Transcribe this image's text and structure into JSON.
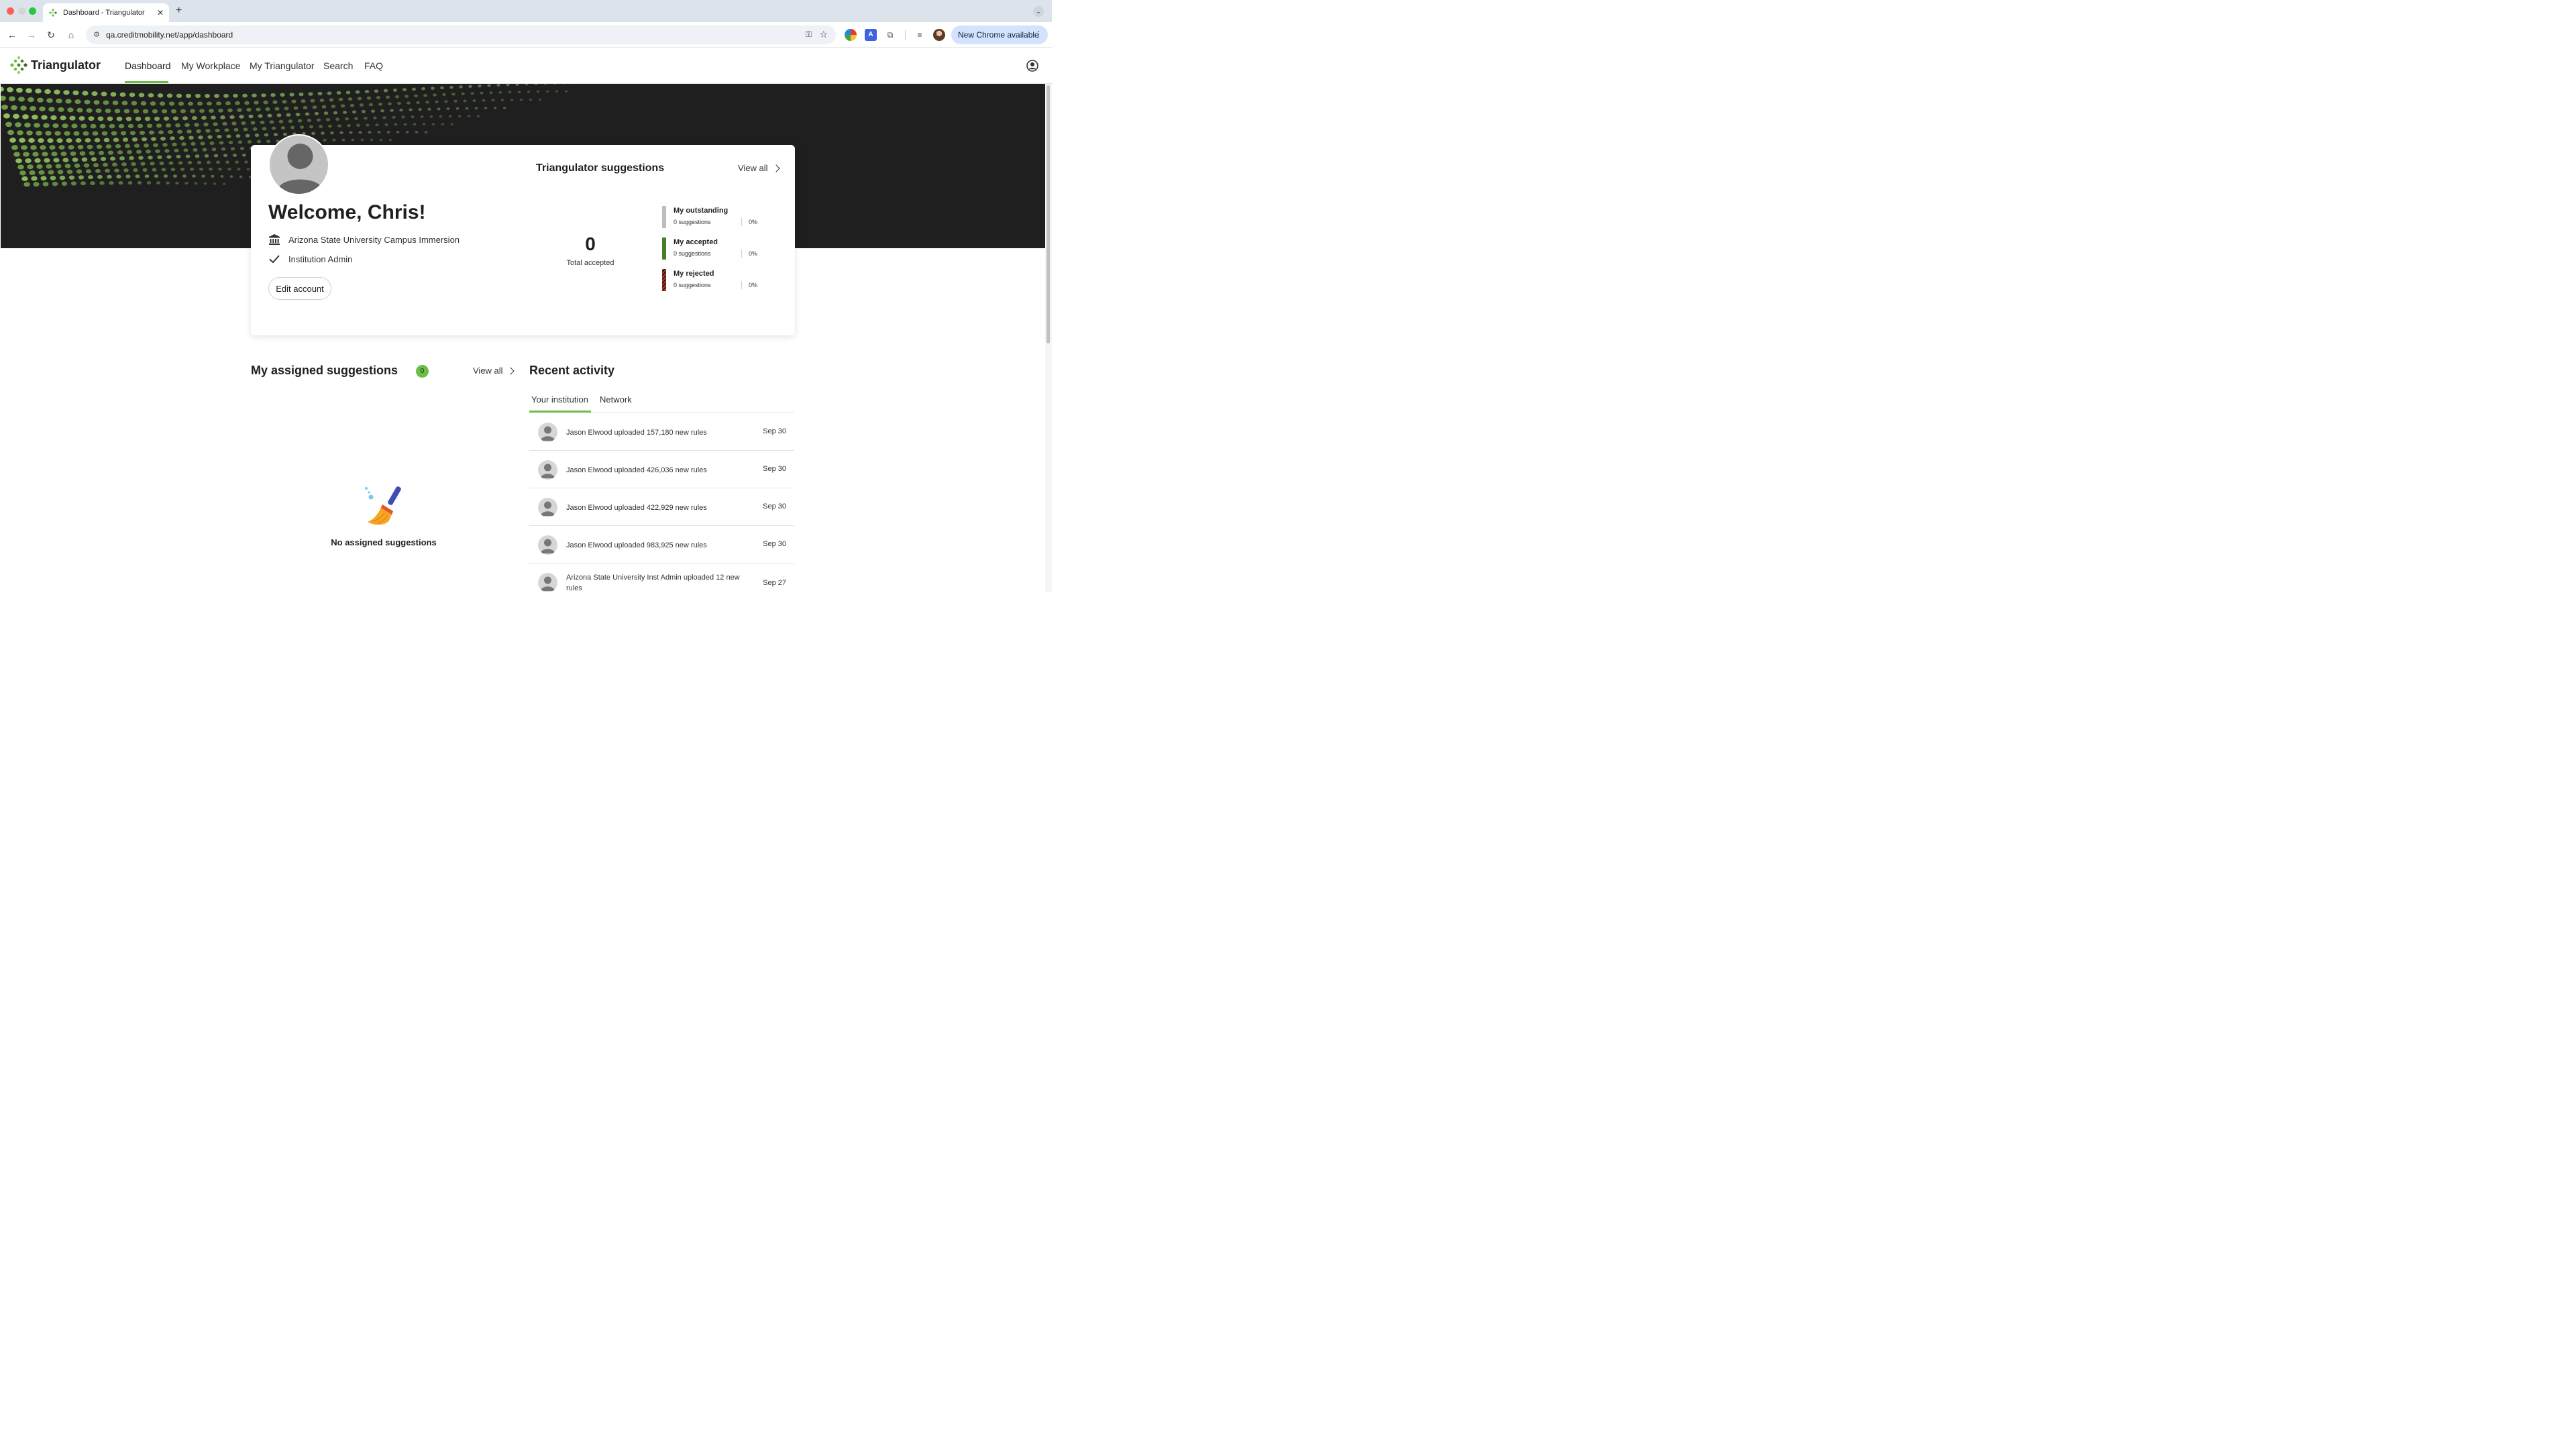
{
  "browser": {
    "tab_title": "Dashboard - Triangulator",
    "tab_close": "✕",
    "new_tab": "+",
    "url": "qa.creditmobility.net/app/dashboard",
    "update_label": "New Chrome available",
    "update_menu": "⋮"
  },
  "app": {
    "brand": "Triangulator",
    "nav": [
      "Dashboard",
      "My Workplace",
      "My Triangulator",
      "Search",
      "FAQ"
    ],
    "active_nav": "Dashboard",
    "accent_color": "#6cbd45"
  },
  "profile": {
    "welcome": "Welcome, Chris!",
    "institution": "Arizona State University Campus Immersion",
    "role": "Institution Admin",
    "edit_label": "Edit account"
  },
  "suggestions": {
    "title": "Triangulator suggestions",
    "view_all": "View all",
    "total_value": "0",
    "total_label": "Total accepted",
    "stats": [
      {
        "title": "My outstanding",
        "sub": "0 suggestions",
        "pct": "0%",
        "color": "#bdbdbd"
      },
      {
        "title": "My accepted",
        "sub": "0 suggestions",
        "pct": "0%",
        "color": "#4a7f2a"
      },
      {
        "title": "My rejected",
        "sub": "0 suggestions",
        "pct": "0%",
        "color": "#b83a2e"
      }
    ]
  },
  "assigned": {
    "title": "My assigned suggestions",
    "count": "0",
    "view_all": "View all",
    "empty_text": "No assigned suggestions"
  },
  "activity": {
    "title": "Recent activity",
    "tabs": [
      "Your institution",
      "Network"
    ],
    "rows": [
      {
        "text": "Jason Elwood uploaded 157,180 new rules",
        "date": "Sep 30"
      },
      {
        "text": "Jason Elwood uploaded 426,036 new rules",
        "date": "Sep 30"
      },
      {
        "text": "Jason Elwood uploaded 422,929 new rules",
        "date": "Sep 30"
      },
      {
        "text": "Jason Elwood uploaded 983,925 new rules",
        "date": "Sep 30"
      },
      {
        "text": "Arizona State University Inst Admin uploaded 12 new rules",
        "date": "Sep 27"
      }
    ]
  }
}
